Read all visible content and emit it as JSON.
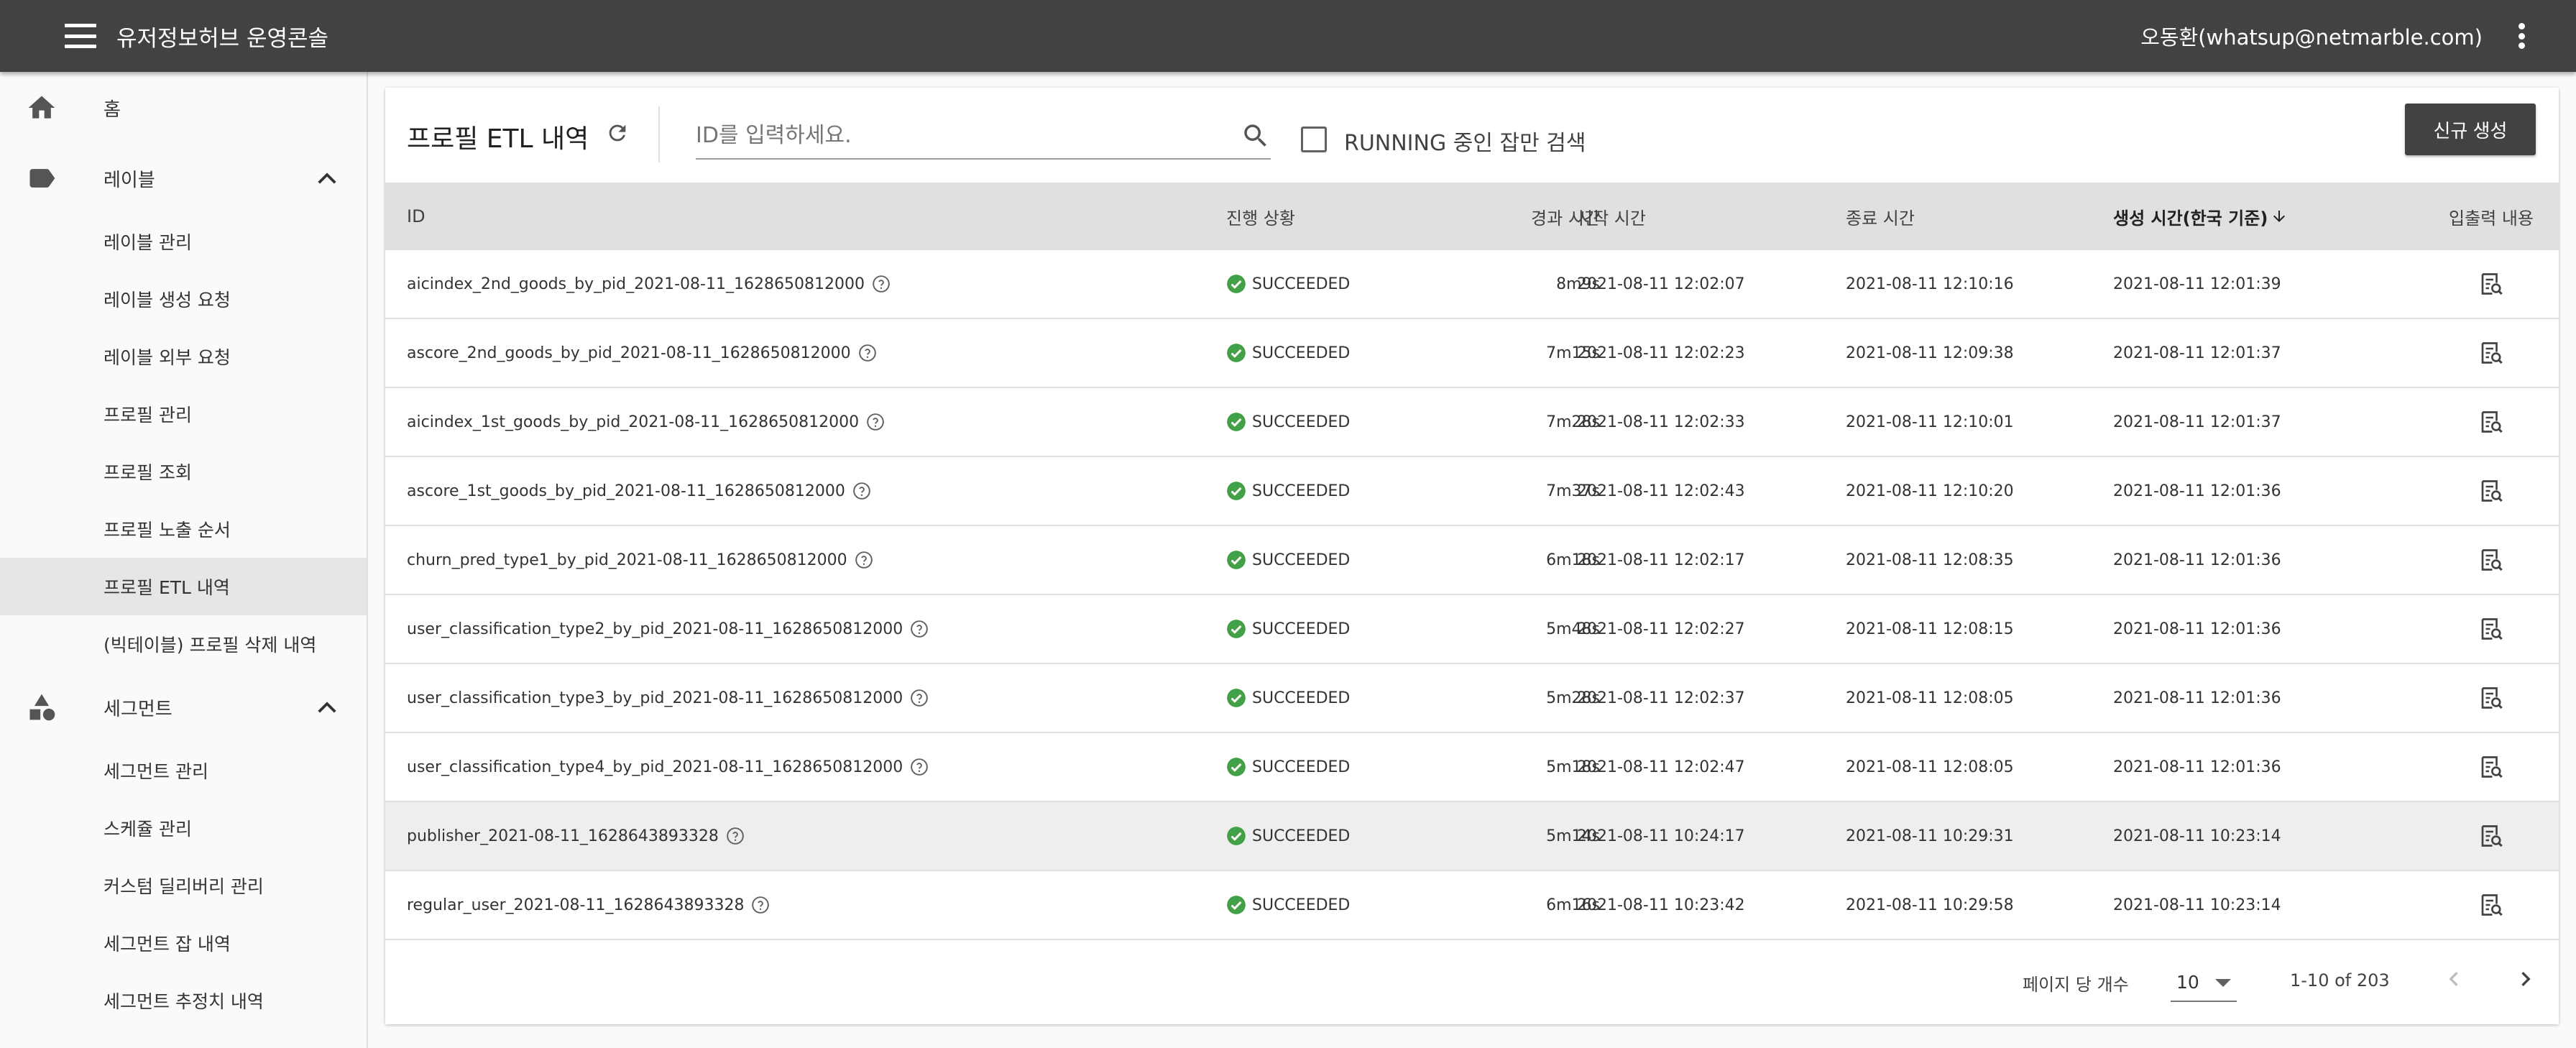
{
  "header": {
    "app_title": "유저정보허브 운영콘솔",
    "user": "오동환(whatsup@netmarble.com)"
  },
  "sidebar": {
    "home": "홈",
    "label_group": {
      "label": "레이블",
      "items": [
        "레이블 관리",
        "레이블 생성 요청",
        "레이블 외부 요청",
        "프로필 관리",
        "프로필 조회",
        "프로필 노출 순서",
        "프로필 ETL 내역",
        "(빅테이블) 프로필 삭제 내역"
      ]
    },
    "segment_group": {
      "label": "세그먼트",
      "items": [
        "세그먼트 관리",
        "스케쥴 관리",
        "커스텀 딜리버리 관리",
        "세그먼트 잡 내역",
        "세그먼트 추정치 내역"
      ]
    },
    "active_item": "프로필 ETL 내역"
  },
  "toolbar": {
    "title": "프로필 ETL 내역",
    "search_placeholder": "ID를 입력하세요.",
    "running_only_label": "RUNNING 중인 잡만 검색",
    "running_only_checked": false,
    "new_button": "신규 생성"
  },
  "table": {
    "headers": {
      "id": "ID",
      "status": "진행 상황",
      "elapsed": "경과 시간",
      "start": "시작 시간",
      "end": "종료 시간",
      "created": "생성 시간(한국 기준)",
      "io": "입출력 내용"
    },
    "sort_column": "created",
    "sort_direction": "desc",
    "rows": [
      {
        "id": "aicindex_2nd_goods_by_pid_2021-08-11_1628650812000",
        "status": "SUCCEEDED",
        "elapsed": "8m9s",
        "start": "2021-08-11 12:02:07",
        "end": "2021-08-11 12:10:16",
        "created": "2021-08-11 12:01:39"
      },
      {
        "id": "ascore_2nd_goods_by_pid_2021-08-11_1628650812000",
        "status": "SUCCEEDED",
        "elapsed": "7m15s",
        "start": "2021-08-11 12:02:23",
        "end": "2021-08-11 12:09:38",
        "created": "2021-08-11 12:01:37"
      },
      {
        "id": "aicindex_1st_goods_by_pid_2021-08-11_1628650812000",
        "status": "SUCCEEDED",
        "elapsed": "7m28s",
        "start": "2021-08-11 12:02:33",
        "end": "2021-08-11 12:10:01",
        "created": "2021-08-11 12:01:37"
      },
      {
        "id": "ascore_1st_goods_by_pid_2021-08-11_1628650812000",
        "status": "SUCCEEDED",
        "elapsed": "7m37s",
        "start": "2021-08-11 12:02:43",
        "end": "2021-08-11 12:10:20",
        "created": "2021-08-11 12:01:36"
      },
      {
        "id": "churn_pred_type1_by_pid_2021-08-11_1628650812000",
        "status": "SUCCEEDED",
        "elapsed": "6m18s",
        "start": "2021-08-11 12:02:17",
        "end": "2021-08-11 12:08:35",
        "created": "2021-08-11 12:01:36"
      },
      {
        "id": "user_classification_type2_by_pid_2021-08-11_1628650812000",
        "status": "SUCCEEDED",
        "elapsed": "5m48s",
        "start": "2021-08-11 12:02:27",
        "end": "2021-08-11 12:08:15",
        "created": "2021-08-11 12:01:36"
      },
      {
        "id": "user_classification_type3_by_pid_2021-08-11_1628650812000",
        "status": "SUCCEEDED",
        "elapsed": "5m28s",
        "start": "2021-08-11 12:02:37",
        "end": "2021-08-11 12:08:05",
        "created": "2021-08-11 12:01:36"
      },
      {
        "id": "user_classification_type4_by_pid_2021-08-11_1628650812000",
        "status": "SUCCEEDED",
        "elapsed": "5m18s",
        "start": "2021-08-11 12:02:47",
        "end": "2021-08-11 12:08:05",
        "created": "2021-08-11 12:01:36"
      },
      {
        "id": "publisher_2021-08-11_1628643893328",
        "status": "SUCCEEDED",
        "elapsed": "5m14s",
        "start": "2021-08-11 10:24:17",
        "end": "2021-08-11 10:29:31",
        "created": "2021-08-11 10:23:14",
        "highlighted": true
      },
      {
        "id": "regular_user_2021-08-11_1628643893328",
        "status": "SUCCEEDED",
        "elapsed": "6m16s",
        "start": "2021-08-11 10:23:42",
        "end": "2021-08-11 10:29:58",
        "created": "2021-08-11 10:23:14"
      }
    ]
  },
  "pagination": {
    "per_page_label": "페이지 당 개수",
    "per_page_value": "10",
    "range": "1-10 of 203"
  },
  "colors": {
    "topbar": "#424242",
    "success": "#43a047",
    "header_row": "#e0e0e0",
    "active_nav": "#e6e6e6"
  }
}
